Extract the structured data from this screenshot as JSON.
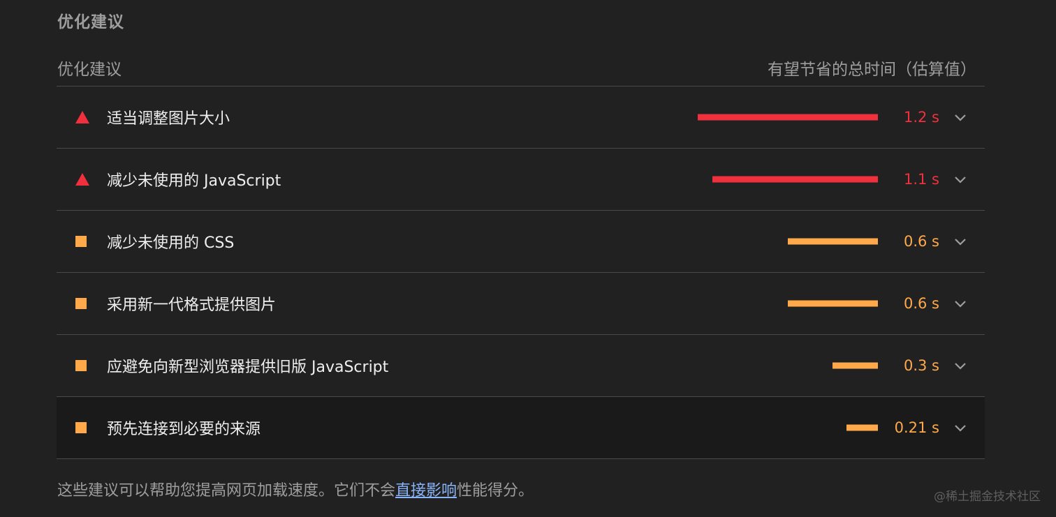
{
  "section_title": "优化建议",
  "table": {
    "col_left": "优化建议",
    "col_right": "有望节省的总时间（估算值）"
  },
  "rows": [
    {
      "label": "适当调整图片大小",
      "value": "1.2 s",
      "severity": "fail",
      "savings_s": 1.2
    },
    {
      "label": "减少未使用的 JavaScript",
      "value": "1.1 s",
      "severity": "fail",
      "savings_s": 1.1
    },
    {
      "label": "减少未使用的 CSS",
      "value": "0.6 s",
      "severity": "average",
      "savings_s": 0.6
    },
    {
      "label": "采用新一代格式提供图片",
      "value": "0.6 s",
      "severity": "average",
      "savings_s": 0.6
    },
    {
      "label": "应避免向新型浏览器提供旧版 JavaScript",
      "value": "0.3 s",
      "severity": "average",
      "savings_s": 0.3
    },
    {
      "label": "预先连接到必要的来源",
      "value": "0.21 s",
      "severity": "average",
      "savings_s": 0.21
    }
  ],
  "footer": {
    "text_before": "这些建议可以帮助您提高网页加载速度。它们不会",
    "link": "直接影响",
    "text_after": "性能得分。"
  },
  "watermark": "@稀土掘金技术社区",
  "colors": {
    "fail": "#f0313d",
    "average": "#ffa94a",
    "background": "#212121"
  },
  "icons": {
    "fail": "triangle-warning-icon",
    "average": "square-average-icon",
    "expand": "chevron-down-icon"
  }
}
